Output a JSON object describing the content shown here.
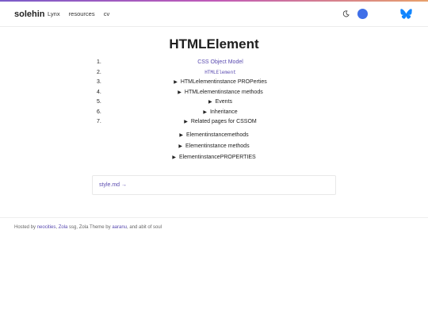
{
  "header": {
    "brand": "solehin",
    "nav": [
      "Lynx",
      "resources",
      "cv"
    ]
  },
  "page": {
    "title": "HTMLElement"
  },
  "toc": [
    {
      "num": "1.",
      "text": "CSS Object Model",
      "style": "link"
    },
    {
      "num": "2.",
      "text": "HTMLElement",
      "style": "mono"
    },
    {
      "num": "3.",
      "text": "HTMLelementinstance PROPerties",
      "style": "tri"
    },
    {
      "num": "4.",
      "text": "HTMLelementinstance methods",
      "style": "tri"
    },
    {
      "num": "5.",
      "text": "Events",
      "style": "tri"
    },
    {
      "num": "6.",
      "text": "Inheritance",
      "style": "tri"
    },
    {
      "num": "7.",
      "text": "Related pages for CSSOM",
      "style": "tri"
    }
  ],
  "extra": [
    {
      "text": "Elementinstancemethods"
    },
    {
      "text": "Elementinstance methods"
    },
    {
      "text": "ElementinstancePROPERTIES"
    }
  ],
  "next_link": "style.md →",
  "footer": {
    "prefix": "Hosted by ",
    "link1": "neocities",
    "sep1": ", ",
    "link2": "Zola",
    "mid": " ssg, Zola Theme by ",
    "link3": "aaranu",
    "suffix": ", and abit of soul"
  },
  "colors": {
    "accent": "#5a4bb0",
    "toggle": "#3f6fe8",
    "bluesky": "#1185fe"
  },
  "icons": [
    "moon-icon",
    "bluesky-icon"
  ]
}
